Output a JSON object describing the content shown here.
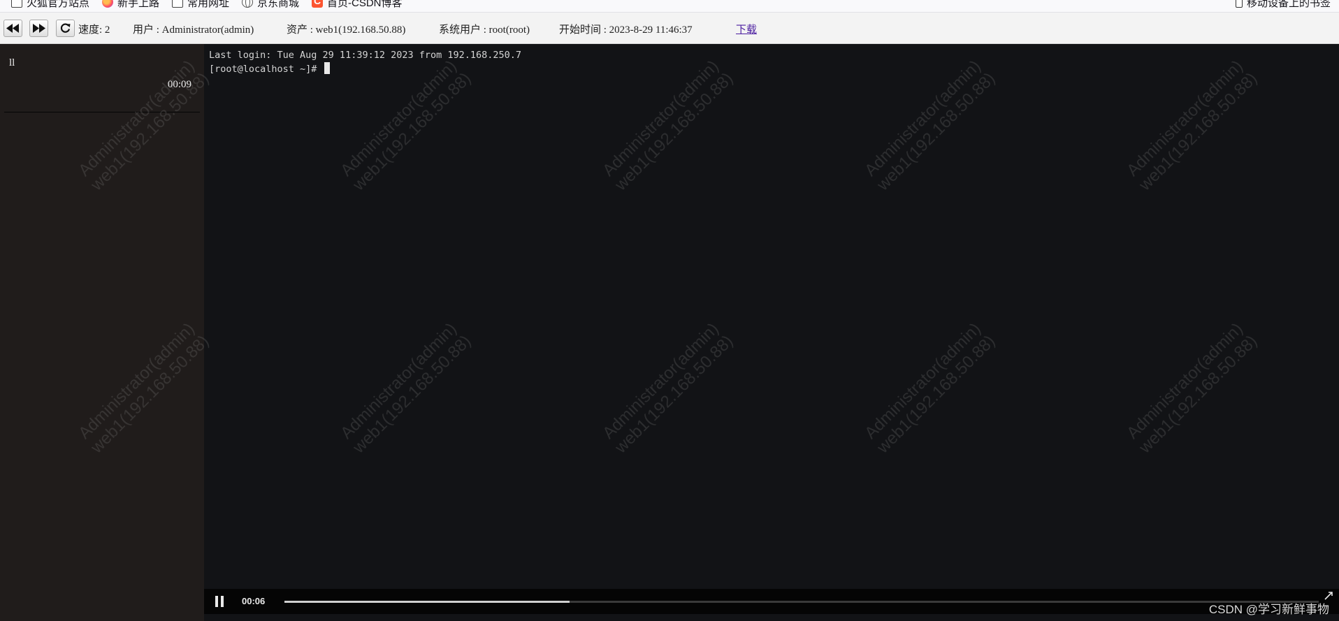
{
  "bookmarks": [
    {
      "label": "火狐官方站点",
      "icon": "folder-icon"
    },
    {
      "label": "新手上路",
      "icon": "firefox-icon"
    },
    {
      "label": "常用网址",
      "icon": "folder-icon"
    },
    {
      "label": "京东商城",
      "icon": "globe-icon"
    },
    {
      "label": "首页-CSDN博客",
      "icon": "csdn-icon"
    }
  ],
  "mobile_bookmarks": "移动设备上的书签",
  "toolbar": {
    "speed": "速度: 2",
    "user": "用户 : Administrator(admin)",
    "asset": "资产 : web1(192.168.50.88)",
    "system_user": "系统用户 : root(root)",
    "start_time": "开始时间 : 2023-8-29 11:46:37",
    "download": "下载",
    "icons": [
      "rewind-icon",
      "fast-forward-icon",
      "refresh-icon"
    ]
  },
  "command_panel": {
    "command": "ll",
    "timestamp": "00:09"
  },
  "terminal": {
    "lines": [
      "Last login: Tue Aug 29 11:39:12 2023 from 192.168.250.7",
      "[root@localhost ~]# "
    ]
  },
  "watermark": {
    "line1": "Administrator(admin)",
    "line2": "web1(192.168.50.88)"
  },
  "player": {
    "current_time": "00:06",
    "progress": 0.276
  },
  "page_watermark": "CSDN @学习新鲜事物"
}
